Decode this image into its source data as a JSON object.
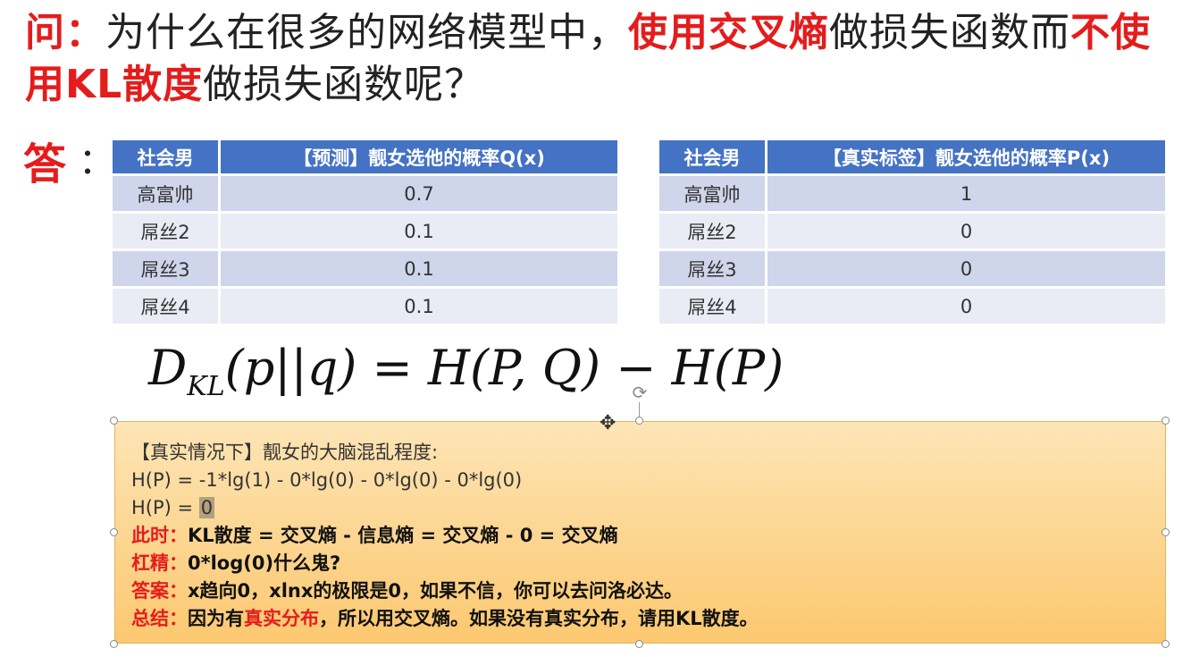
{
  "question": {
    "label": "问：",
    "part1": "为什么在很多的网络模型中，",
    "highlight1": "使用交叉熵",
    "part2": "做损失函数而",
    "highlight2": "不使用KL散度",
    "part3": "做损失函数呢？"
  },
  "answer": {
    "label": "答",
    "colon": "："
  },
  "table_q": {
    "headers": [
      "社会男",
      "【预测】靓女选他的概率Q(x)"
    ],
    "rows": [
      [
        "高富帅",
        "0.7"
      ],
      [
        "屌丝2",
        "0.1"
      ],
      [
        "屌丝3",
        "0.1"
      ],
      [
        "屌丝4",
        "0.1"
      ]
    ]
  },
  "table_p": {
    "headers": [
      "社会男",
      "【真实标签】靓女选他的概率P(x)"
    ],
    "rows": [
      [
        "高富帅",
        "1"
      ],
      [
        "屌丝2",
        "0"
      ],
      [
        "屌丝3",
        "0"
      ],
      [
        "屌丝4",
        "0"
      ]
    ]
  },
  "formula": {
    "d": "D",
    "sub": "KL",
    "rest": "(p||q) = H(P, Q) − H(P)"
  },
  "box": {
    "line1": "【真实情况下】靓女的大脑混乱程度:",
    "line2": "H(P) = -1*lg(1) - 0*lg(0) - 0*lg(0) - 0*lg(0)",
    "line3_prefix": "H(P) = ",
    "line3_value": "0",
    "line4_label": "此时：",
    "line4_text": "KL散度 = 交叉熵 - 信息熵 = 交叉熵 - 0 = 交叉熵",
    "line5_label": "杠精：",
    "line5_text": "0*log(0)什么鬼?",
    "line6_label": "答案：",
    "line6_text": "x趋向0，xlnx的极限是0，如果不信，你可以去问洛必达。",
    "line7_label": "总结：",
    "line7_text1": "因为有",
    "line7_red": "真实分布",
    "line7_text2": "，所以用交叉熵。如果没有真实分布，请用KL散度。"
  },
  "colors": {
    "accent_red": "#e51c1c",
    "table_header": "#4472c4",
    "box_fill": "#fcc870"
  }
}
